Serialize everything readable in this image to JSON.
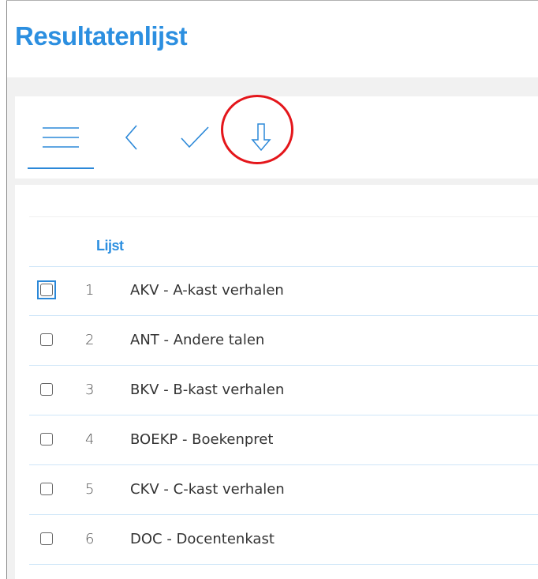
{
  "header": {
    "title": "Resultatenlijst"
  },
  "toolbar": {
    "buttons": [
      {
        "name": "menu",
        "icon": "hamburger-icon",
        "active": true
      },
      {
        "name": "back",
        "icon": "chevron-left-icon"
      },
      {
        "name": "confirm",
        "icon": "checkmark-icon"
      },
      {
        "name": "download",
        "icon": "arrow-down-icon",
        "highlighted": true
      }
    ]
  },
  "list": {
    "column_header": "Lijst",
    "rows": [
      {
        "num": "1",
        "label": "AKV - A-kast verhalen",
        "checked": false,
        "focused": true
      },
      {
        "num": "2",
        "label": "ANT - Andere talen",
        "checked": false
      },
      {
        "num": "3",
        "label": "BKV - B-kast verhalen",
        "checked": false
      },
      {
        "num": "4",
        "label": "BOEKP - Boekenpret",
        "checked": false
      },
      {
        "num": "5",
        "label": "CKV - C-kast verhalen",
        "checked": false
      },
      {
        "num": "6",
        "label": "DOC - Docentenkast",
        "checked": false
      }
    ]
  },
  "colors": {
    "accent": "#2c8fe0",
    "highlight": "#e4161b",
    "background": "#f1f1f1"
  }
}
